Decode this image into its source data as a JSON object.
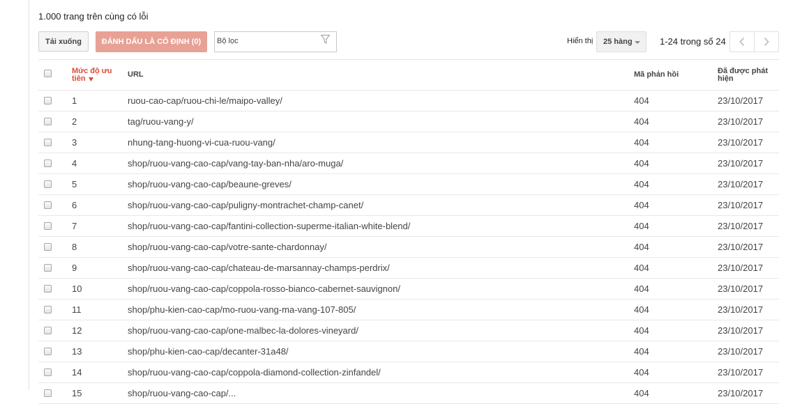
{
  "page": {
    "title": "1.000 trang trên cùng có lỗi"
  },
  "toolbar": {
    "download_label": "Tải xuống",
    "mark_fixed_label": "ĐÁNH DẤU LÀ CỐ ĐỊNH (0)",
    "filter_placeholder": "Bộ lọc",
    "show_label": "Hiển thị",
    "rows_option": "25 hàng",
    "range_text": "1-24 trong số 24"
  },
  "table": {
    "columns": {
      "priority": "Mức độ ưu tiên",
      "url": "URL",
      "response_code": "Mã phản hồi",
      "detected": "Đã được phát hiện"
    },
    "rows": [
      {
        "priority": "1",
        "url": "ruou-cao-cap/ruou-chi-le/maipo-valley/",
        "code": "404",
        "date": "23/10/2017"
      },
      {
        "priority": "2",
        "url": "tag/ruou-vang-y/",
        "code": "404",
        "date": "23/10/2017"
      },
      {
        "priority": "3",
        "url": "nhung-tang-huong-vi-cua-ruou-vang/",
        "code": "404",
        "date": "23/10/2017"
      },
      {
        "priority": "4",
        "url": "shop/ruou-vang-cao-cap/vang-tay-ban-nha/aro-muga/",
        "code": "404",
        "date": "23/10/2017"
      },
      {
        "priority": "5",
        "url": "shop/ruou-vang-cao-cap/beaune-greves/",
        "code": "404",
        "date": "23/10/2017"
      },
      {
        "priority": "6",
        "url": "shop/ruou-vang-cao-cap/puligny-montrachet-champ-canet/",
        "code": "404",
        "date": "23/10/2017"
      },
      {
        "priority": "7",
        "url": "shop/ruou-vang-cao-cap/fantini-collection-superme-italian-white-blend/",
        "code": "404",
        "date": "23/10/2017"
      },
      {
        "priority": "8",
        "url": "shop/ruou-vang-cao-cap/votre-sante-chardonnay/",
        "code": "404",
        "date": "23/10/2017"
      },
      {
        "priority": "9",
        "url": "shop/ruou-vang-cao-cap/chateau-de-marsannay-champs-perdrix/",
        "code": "404",
        "date": "23/10/2017"
      },
      {
        "priority": "10",
        "url": "shop/ruou-vang-cao-cap/coppola-rosso-bianco-cabernet-sauvignon/",
        "code": "404",
        "date": "23/10/2017"
      },
      {
        "priority": "11",
        "url": "shop/phu-kien-cao-cap/mo-ruou-vang-ma-vang-107-805/",
        "code": "404",
        "date": "23/10/2017"
      },
      {
        "priority": "12",
        "url": "shop/ruou-vang-cao-cap/one-malbec-la-dolores-vineyard/",
        "code": "404",
        "date": "23/10/2017"
      },
      {
        "priority": "13",
        "url": "shop/phu-kien-cao-cap/decanter-31a48/",
        "code": "404",
        "date": "23/10/2017"
      },
      {
        "priority": "14",
        "url": "shop/ruou-vang-cao-cap/coppola-diamond-collection-zinfandel/",
        "code": "404",
        "date": "23/10/2017"
      },
      {
        "priority": "15",
        "url": "shop/ruou-vang-cao-cap/...",
        "code": "404",
        "date": "23/10/2017"
      }
    ]
  }
}
